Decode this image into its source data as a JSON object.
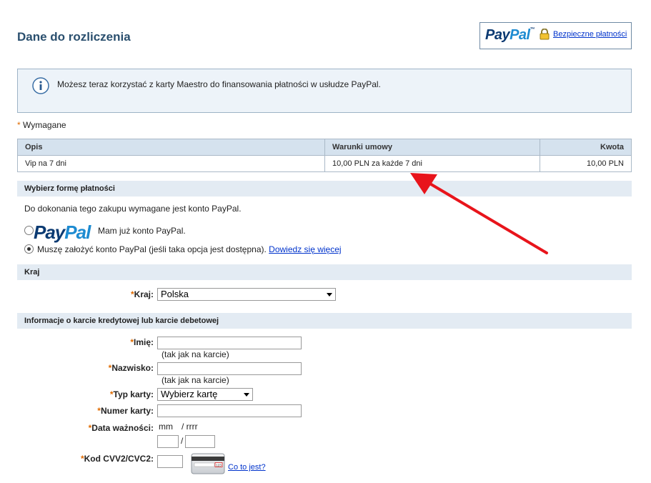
{
  "page": {
    "title": "Dane do rozliczenia"
  },
  "badge": {
    "logo_a": "Pay",
    "logo_b": "Pal",
    "tm": "™",
    "link": "Bezpieczne płatności"
  },
  "info": {
    "text": "Możesz teraz korzystać z karty Maestro do finansowania płatności w usłudze PayPal."
  },
  "required": {
    "star": "*",
    "label": "Wymagane"
  },
  "table": {
    "headers": [
      "Opis",
      "Warunki umowy",
      "Kwota"
    ],
    "rows": [
      [
        "Vip na 7 dni",
        "10,00 PLN za każde 7 dni",
        "10,00 PLN"
      ]
    ]
  },
  "payment": {
    "section_title": "Wybierz formę płatności",
    "note": "Do dokonania tego zakupu wymagane jest konto PayPal.",
    "logo_a": "Pay",
    "logo_b": "Pal",
    "option_has_account": "Mam już konto PayPal.",
    "option_create": "Muszę założyć konto PayPal (jeśli taka opcja jest dostępna).",
    "learn_more": "Dowiedz się więcej"
  },
  "country": {
    "section_title": "Kraj",
    "label": "Kraj:",
    "value": "Polska"
  },
  "card": {
    "section_title": "Informacje o karcie kredytowej lub karcie debetowej",
    "first_name_label": "Imię:",
    "last_name_label": "Nazwisko:",
    "as_on_card": "(tak jak na karcie)",
    "card_type_label": "Typ karty:",
    "card_type_value": "Wybierz kartę",
    "card_number_label": "Numer karty:",
    "expiry_label": "Data ważności:",
    "expiry_format_mm": "mm",
    "expiry_format_yyyy": "/ rrrr",
    "slash": "/",
    "cvv_label": "Kod CVV2/CVC2:",
    "cvv_card_digits": "123",
    "cvv_help": "Co to jest?"
  },
  "colors": {
    "accent": "#2a4f6e",
    "required_star": "#e06b00",
    "arrow": "#e8141b",
    "link": "#0033cc"
  }
}
